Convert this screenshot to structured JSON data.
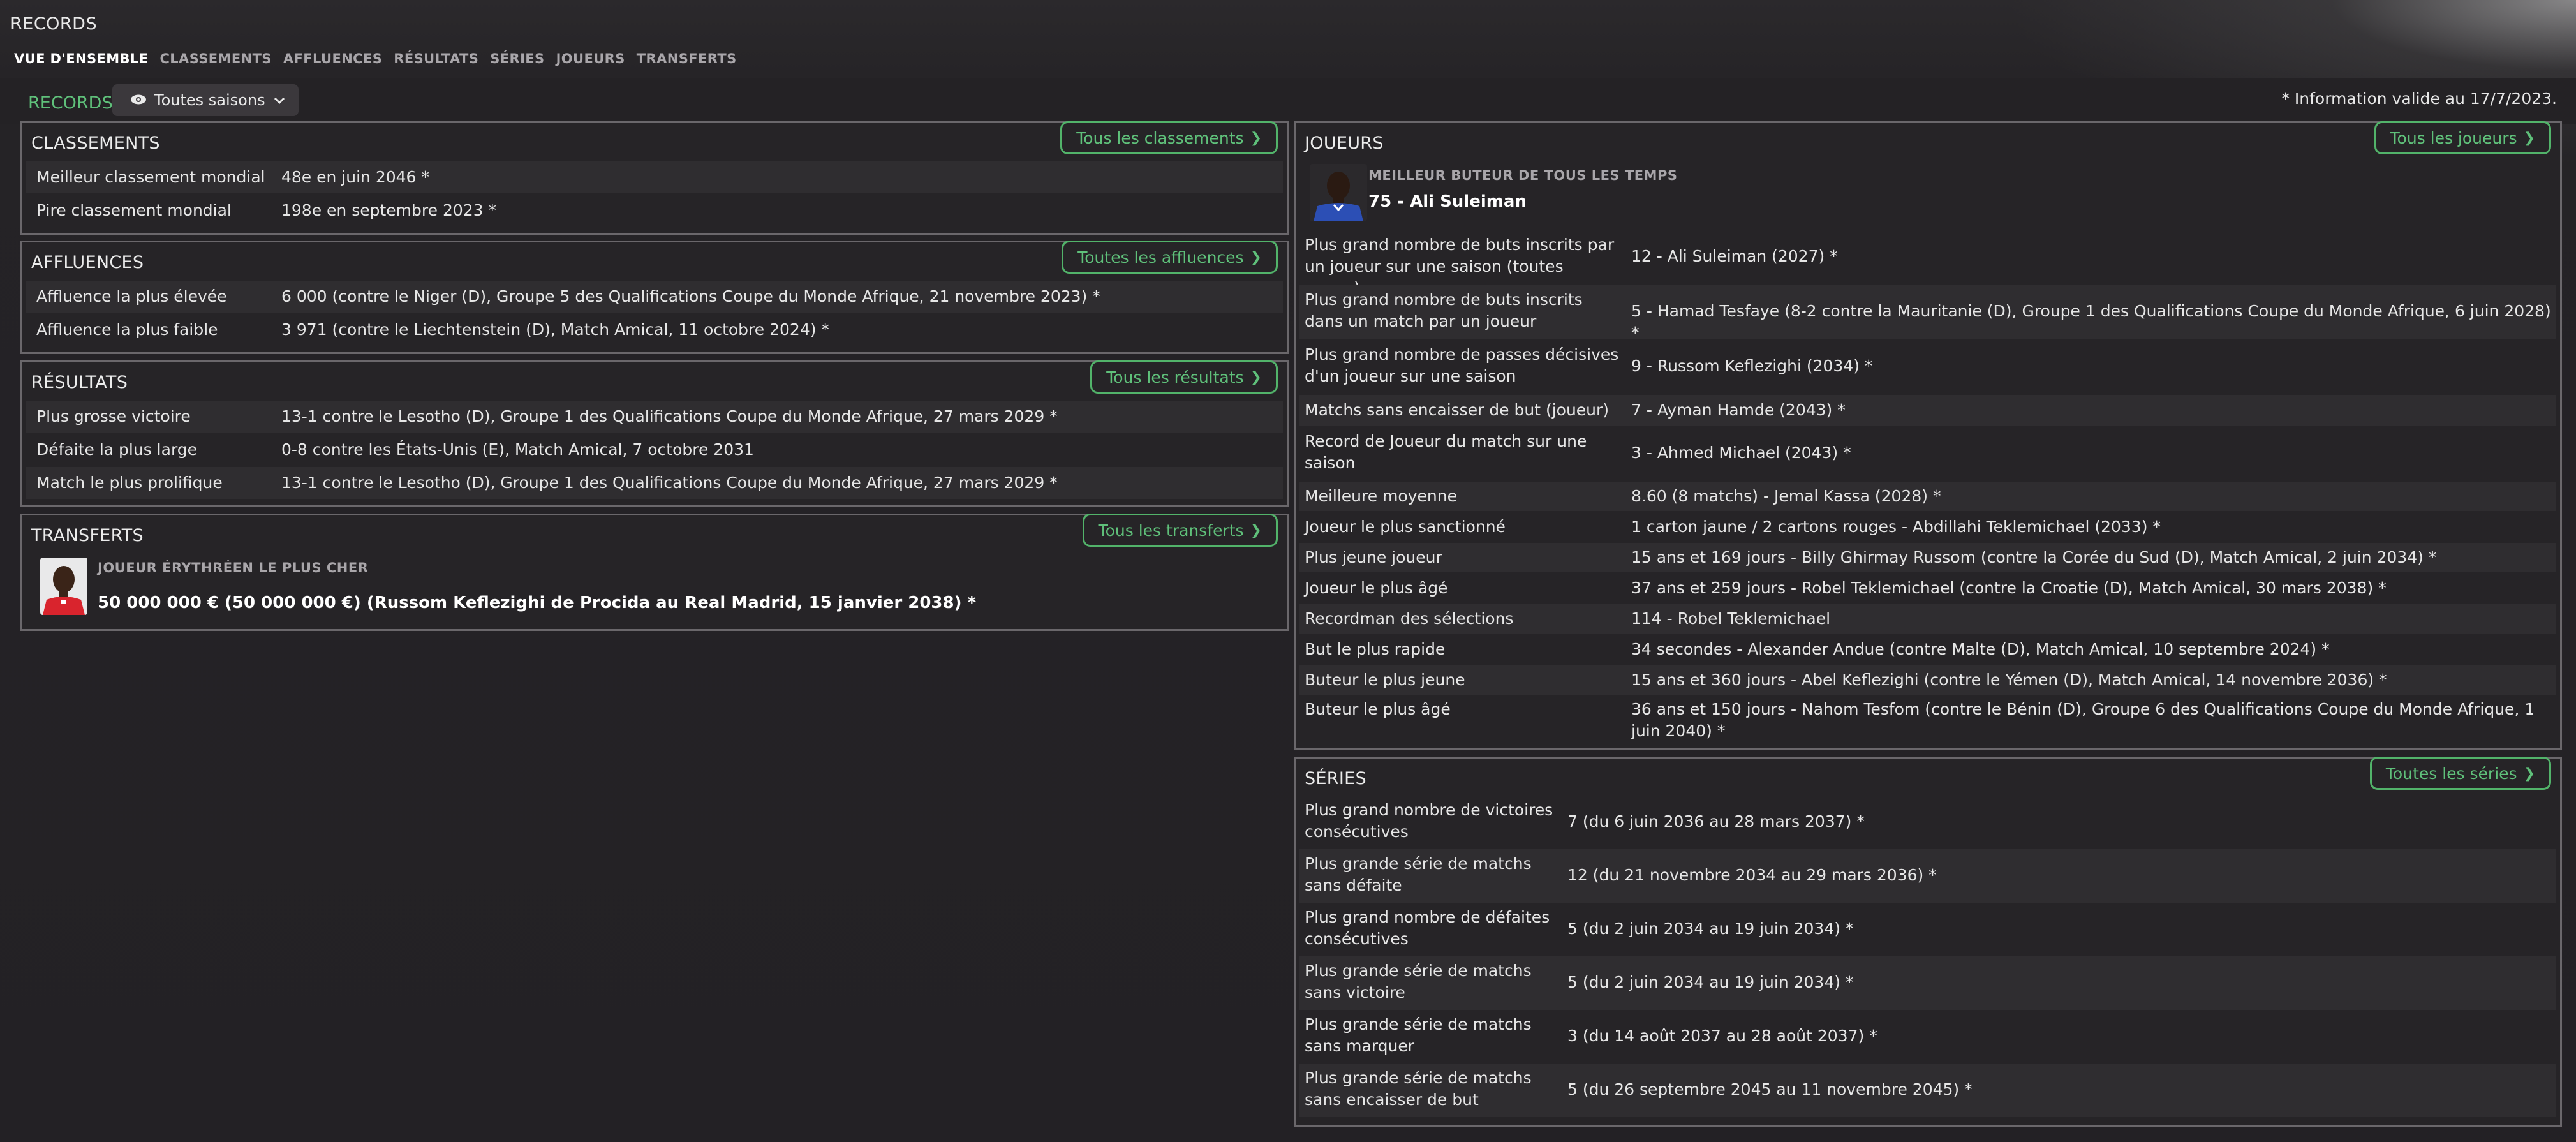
{
  "page": {
    "title": "RECORDS"
  },
  "nav": {
    "tabs": [
      {
        "label": "VUE D'ENSEMBLE",
        "active": true
      },
      {
        "label": "CLASSEMENTS"
      },
      {
        "label": "AFFLUENCES"
      },
      {
        "label": "RÉSULTATS"
      },
      {
        "label": "SÉRIES"
      },
      {
        "label": "JOUEURS"
      },
      {
        "label": "TRANSFERTS"
      }
    ]
  },
  "subbar": {
    "records_label": "RECORDS",
    "season_dropdown": "Toutes saisons",
    "valid_note": "* Information valide au 17/7/2023."
  },
  "classements": {
    "title": "CLASSEMENTS",
    "button": "Tous les classements",
    "rows": [
      {
        "label": "Meilleur classement mondial",
        "value": "48e en juin 2046 *"
      },
      {
        "label": "Pire classement mondial",
        "value": "198e en septembre 2023 *"
      }
    ]
  },
  "affluences": {
    "title": "AFFLUENCES",
    "button": "Toutes les affluences",
    "rows": [
      {
        "label": "Affluence la plus élevée",
        "value": "6 000 (contre le Niger (D), Groupe 5 des Qualifications Coupe du Monde Afrique, 21 novembre 2023) *"
      },
      {
        "label": "Affluence la plus faible",
        "value": "3 971 (contre le Liechtenstein (D), Match Amical, 11 octobre 2024) *"
      }
    ]
  },
  "resultats": {
    "title": "RÉSULTATS",
    "button": "Tous les résultats",
    "rows": [
      {
        "label": "Plus grosse victoire",
        "value": "13-1 contre le Lesotho (D), Groupe 1 des Qualifications Coupe du Monde Afrique, 27 mars 2029 *"
      },
      {
        "label": "Défaite la plus large",
        "value": "0-8 contre les États-Unis (E), Match Amical, 7 octobre 2031"
      },
      {
        "label": "Match le plus prolifique",
        "value": "13-1 contre le Lesotho (D), Groupe 1 des Qualifications Coupe du Monde Afrique, 27 mars 2029 *"
      }
    ]
  },
  "transferts": {
    "title": "TRANSFERTS",
    "button": "Tous les transferts",
    "caption": "JOUEUR ÉRYTHRÉEN LE PLUS CHER",
    "value": "50 000 000 € (50 000 000 €) (Russom Keflezighi de Procida au Real Madrid, 15 janvier 2038) *"
  },
  "joueurs": {
    "title": "JOUEURS",
    "button": "Tous les joueurs",
    "caption": "MEILLEUR BUTEUR DE TOUS LES TEMPS",
    "top_scorer": "75 - Ali Suleiman",
    "rows": [
      {
        "label": "Plus grand nombre de buts inscrits par un joueur sur une saison (toutes comp.)",
        "value": "12 - Ali Suleiman (2027) *"
      },
      {
        "label": "Plus grand nombre de buts inscrits dans un match par un joueur",
        "value": "5 - Hamad Tesfaye (8-2 contre la Mauritanie (D), Groupe 1 des Qualifications Coupe du Monde Afrique, 6 juin 2028) *"
      },
      {
        "label": "Plus grand nombre de passes décisives d'un joueur sur une saison",
        "value": "9 - Russom Keflezighi (2034) *"
      },
      {
        "label": "Matchs sans encaisser de but (joueur)",
        "value": "7 - Ayman Hamde (2043) *"
      },
      {
        "label": "Record de Joueur du match sur une saison",
        "value": "3 - Ahmed Michael (2043) *"
      },
      {
        "label": "Meilleure moyenne",
        "value": "8.60 (8 matchs) - Jemal Kassa (2028) *"
      },
      {
        "label": "Joueur le plus sanctionné",
        "value": "1 carton jaune / 2 cartons rouges - Abdillahi Teklemichael (2033) *"
      },
      {
        "label": "Plus jeune joueur",
        "value": "15 ans et 169 jours - Billy Ghirmay Russom (contre la Corée du Sud (D), Match Amical, 2 juin 2034) *"
      },
      {
        "label": "Joueur le plus âgé",
        "value": "37 ans et 259 jours - Robel Teklemichael (contre la Croatie (D), Match Amical, 30 mars 2038) *"
      },
      {
        "label": "Recordman des sélections",
        "value": "114 - Robel Teklemichael"
      },
      {
        "label": "But le plus rapide",
        "value": "34 secondes - Alexander Andue (contre Malte (D), Match Amical, 10 septembre 2024) *"
      },
      {
        "label": "Buteur le plus jeune",
        "value": "15 ans et 360 jours - Abel Keflezighi (contre le Yémen (D), Match Amical, 14 novembre 2036) *"
      },
      {
        "label": "Buteur le plus âgé",
        "value": "36 ans et 150 jours - Nahom Tesfom (contre le Bénin (D), Groupe 6 des Qualifications Coupe du Monde Afrique, 1 juin 2040) *"
      }
    ]
  },
  "series": {
    "title": "SÉRIES",
    "button": "Toutes les séries",
    "rows": [
      {
        "label": "Plus grand nombre de victoires consécutives",
        "value": "7 (du 6 juin 2036 au 28 mars 2037) *"
      },
      {
        "label": "Plus grande série de matchs sans défaite",
        "value": "12 (du 21 novembre 2034 au 29 mars 2036) *"
      },
      {
        "label": "Plus grand nombre de défaites consécutives",
        "value": "5 (du 2 juin 2034 au 19 juin 2034) *"
      },
      {
        "label": "Plus grande série de matchs sans victoire",
        "value": "5 (du 2 juin 2034 au 19 juin 2034) *"
      },
      {
        "label": "Plus grande série de matchs sans marquer",
        "value": "3 (du 14 août 2037 au 28 août 2037) *"
      },
      {
        "label": "Plus grande série de matchs sans encaisser de but",
        "value": "5 (du 26 septembre 2045 au 11 novembre 2045) *"
      }
    ]
  },
  "colors": {
    "accent": "#5fc07a",
    "panel_border": "#6a676b",
    "background": "#232125"
  }
}
